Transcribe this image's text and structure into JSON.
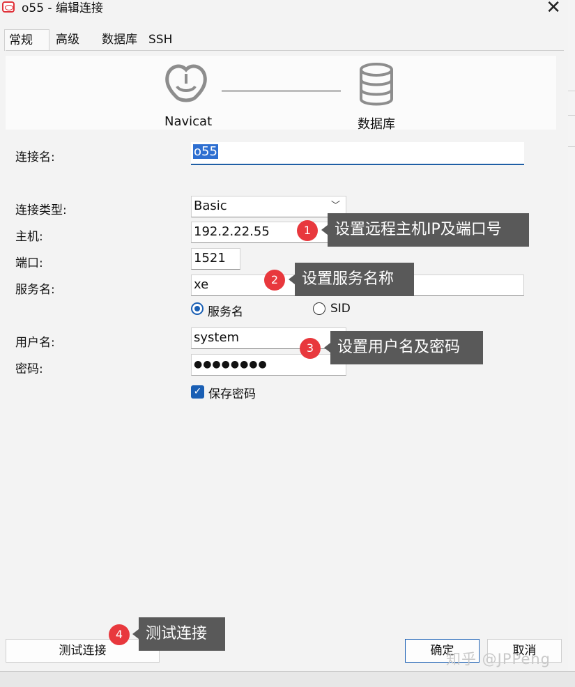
{
  "window": {
    "title": "o55 - 编辑连接",
    "close_glyph": "✕"
  },
  "tabs": [
    {
      "label": "常规",
      "active": true
    },
    {
      "label": "高级",
      "active": false
    },
    {
      "label": "数据库",
      "active": false
    },
    {
      "label": "SSH",
      "active": false
    }
  ],
  "banner": {
    "left_label": "Navicat",
    "right_label": "数据库",
    "left_icon": "navicat-icon",
    "right_icon": "database-icon"
  },
  "form": {
    "connection_name": {
      "label": "连接名:",
      "value": "o55"
    },
    "connection_type": {
      "label": "连接类型:",
      "value": "Basic"
    },
    "host": {
      "label": "主机:",
      "value": "192.2.22.55"
    },
    "port": {
      "label": "端口:",
      "value": "1521"
    },
    "service_name": {
      "label": "服务名:",
      "value": "xe"
    },
    "service_options": {
      "service_label": "服务名",
      "sid_label": "SID",
      "selected": "服务名"
    },
    "username": {
      "label": "用户名:",
      "value": "system"
    },
    "password": {
      "label": "密码:",
      "value": "●●●●●●●●"
    },
    "save_password": {
      "label": "保存密码",
      "checked": true
    }
  },
  "callouts": [
    {
      "number": "1",
      "text": "设置远程主机IP及端口号"
    },
    {
      "number": "2",
      "text": "设置服务名称"
    },
    {
      "number": "3",
      "text": "设置用户名及密码"
    },
    {
      "number": "4",
      "text": "测试连接"
    }
  ],
  "buttons": {
    "test": "测试连接",
    "ok": "确定",
    "cancel": "取消"
  },
  "watermark": "知乎 @JPPeng",
  "colors": {
    "accent": "#1a5fb4",
    "badge": "#e8383d",
    "callout_bg": "#595959"
  }
}
